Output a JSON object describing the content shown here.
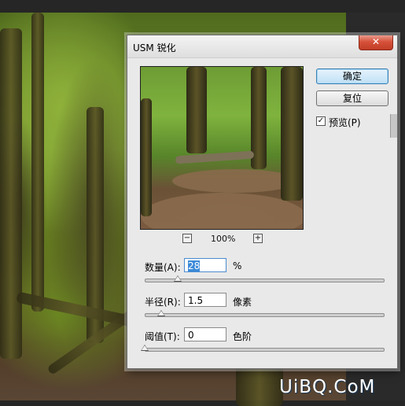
{
  "dialog": {
    "title": "USM 锐化",
    "close_label": "✕"
  },
  "buttons": {
    "ok_label": "确定",
    "reset_label": "复位"
  },
  "preview": {
    "checked": true,
    "check_glyph": "✓",
    "label": "预览(P)"
  },
  "zoom": {
    "minus": "−",
    "value": "100%",
    "plus": "+"
  },
  "amount": {
    "label": "数量(A):",
    "value": "28",
    "unit": "%",
    "slider_fraction": 0.14
  },
  "radius": {
    "label": "半径(R):",
    "value": "1.5",
    "unit": "像素",
    "slider_fraction": 0.07
  },
  "threshold": {
    "label": "阈值(T):",
    "value": "0",
    "unit": "色阶",
    "slider_fraction": 0.0
  },
  "watermark": "UiBQ.CoM",
  "colors": {
    "ok_button_accent": "#bfe0f6",
    "close_button": "#d7513a",
    "selection": "#3c8ad8"
  }
}
